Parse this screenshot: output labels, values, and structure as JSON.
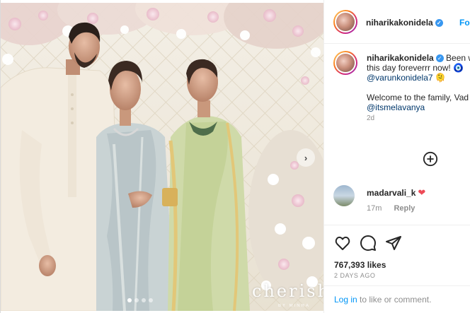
{
  "post": {
    "author": "niharikakonidela",
    "follow_label": "Follo",
    "photo_watermark": "cherish",
    "photo_watermark_sub": "BY MINHA",
    "carousel": {
      "dot_count": 4,
      "active_index": 0
    },
    "caption": {
      "author": "niharikakonidela",
      "line1": "Been w",
      "line2": "this day foreverrr now!",
      "emoji1": "🧿",
      "mention1": "@varunkonidela7",
      "emoji2": "🫠",
      "line4": "Welcome to the family, Vad",
      "mention2": "@itsmelavanya",
      "time": "2d"
    },
    "comment": {
      "user": "madarvali_k",
      "heart": "❤",
      "time": "17m",
      "reply_label": "Reply"
    },
    "likes": "767,393 likes",
    "date": "2 DAYS AGO",
    "login": {
      "link": "Log in",
      "rest": "to like or comment."
    }
  },
  "icons": {
    "verified": "verified-badge-icon",
    "add": "add-comment-circle-icon",
    "like": "heart-outline-icon",
    "comment": "speech-bubble-icon",
    "share": "paper-plane-icon",
    "next": "chevron-right-icon"
  },
  "colors": {
    "link_blue": "#0095f6",
    "mention_blue": "#00376b",
    "muted": "#8e8e8e",
    "heart_red": "#ed4956",
    "verified_blue": "#3897f0"
  }
}
